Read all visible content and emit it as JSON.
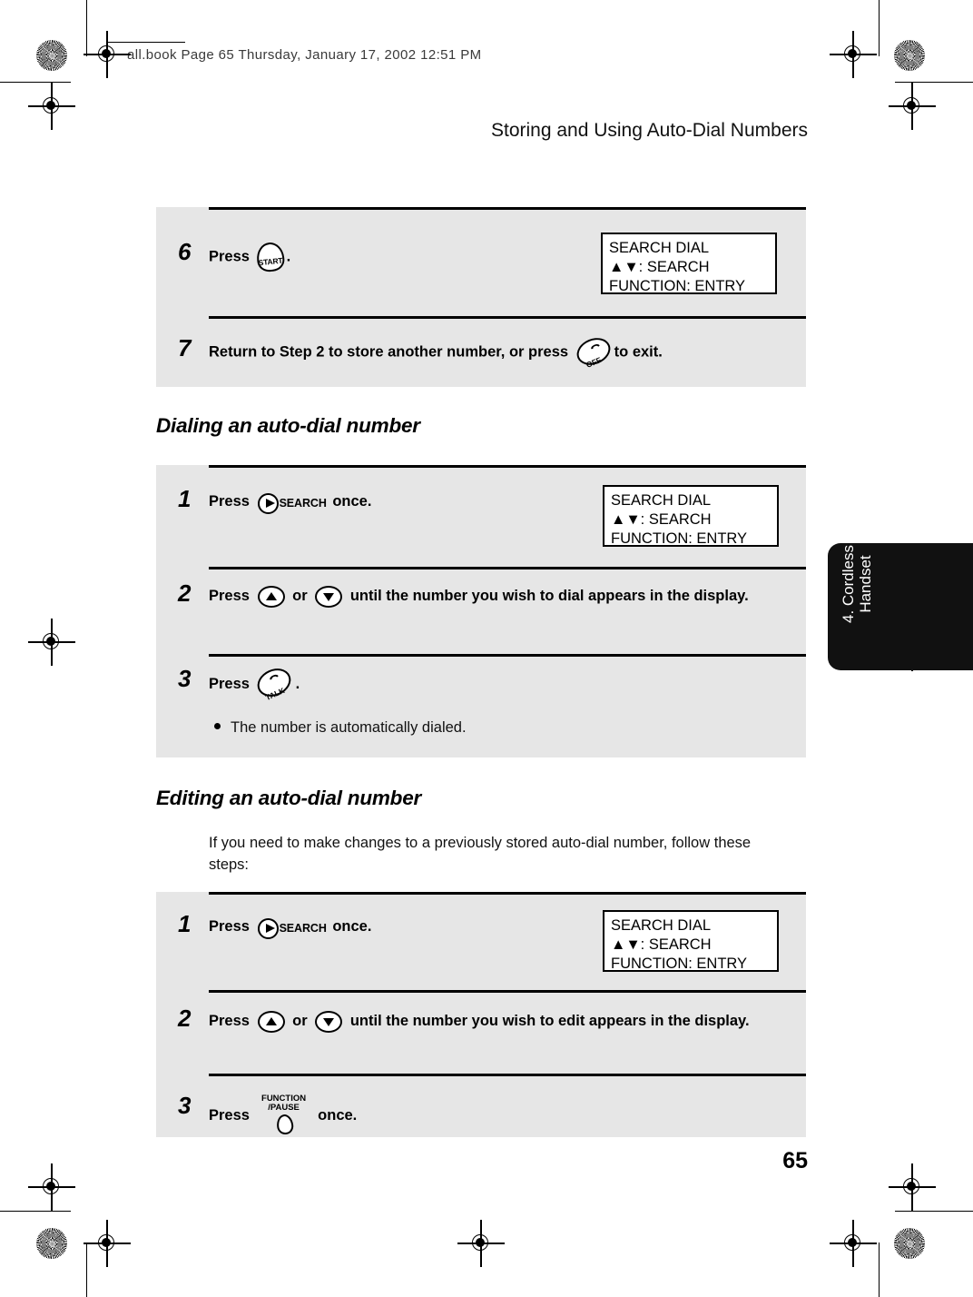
{
  "document": {
    "file_header": "all.book  Page 65  Thursday, January 17, 2002  12:51 PM",
    "running_head": "Storing and Using Auto-Dial Numbers",
    "page_number": "65",
    "thumb_tab": "4. Cordless\nHandset"
  },
  "keys": {
    "start": {
      "icon": "start-key-icon",
      "label": "START"
    },
    "off": {
      "icon": "off-key-icon",
      "label": "OFF"
    },
    "talk": {
      "icon": "talk-key-icon",
      "label": "TALK"
    },
    "search": {
      "icon": "search-key-icon",
      "label": "SEARCH"
    },
    "up": {
      "icon": "up-arrow-key-icon",
      "label": ""
    },
    "down": {
      "icon": "down-arrow-key-icon",
      "label": ""
    },
    "function_pause": {
      "icon": "function-pause-key-icon",
      "label": "FUNCTION\n/PAUSE"
    }
  },
  "lcd": {
    "search_dial": "SEARCH DIAL\n▲▼: SEARCH\nFUNCTION: ENTRY"
  },
  "sections": {
    "storing": {
      "steps": [
        {
          "num": "6",
          "text_before": "Press",
          "text_after": "."
        },
        {
          "num": "7",
          "text_before": "Return to Step 2 to store another number, or press",
          "text_after": "to exit."
        }
      ]
    },
    "dialing": {
      "heading": "Dialing an auto-dial number",
      "steps": [
        {
          "num": "1",
          "text_before": "Press",
          "text_after": "once."
        },
        {
          "num": "2",
          "text_before": "Press",
          "text_middle": "or",
          "text_after": "until the number you wish to dial appears in the display."
        },
        {
          "num": "3",
          "text_before": "Press",
          "text_after": ".",
          "bullet": "The number is automatically dialed."
        }
      ]
    },
    "editing": {
      "heading": "Editing an auto-dial number",
      "intro": "If you need to make changes to a previously stored auto-dial number, follow these steps:",
      "steps": [
        {
          "num": "1",
          "text_before": "Press",
          "text_after": "once."
        },
        {
          "num": "2",
          "text_before": "Press",
          "text_middle": "or",
          "text_after": "until the number you wish to edit appears in the display."
        },
        {
          "num": "3",
          "text_before": "Press",
          "text_after": "once."
        }
      ]
    }
  }
}
